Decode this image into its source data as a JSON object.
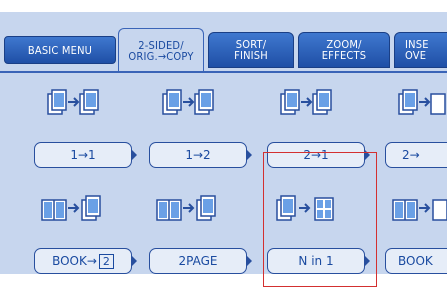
{
  "tabs": [
    {
      "id": "basic",
      "line1": "BASIC MENU",
      "line2": ""
    },
    {
      "id": "2sided",
      "line1": "2-SIDED/",
      "line2": "ORIG.→COPY"
    },
    {
      "id": "sort",
      "line1": "SORT/",
      "line2": "FINISH"
    },
    {
      "id": "zoom",
      "line1": "ZOOM/",
      "line2": "EFFECTS"
    },
    {
      "id": "inse",
      "line1": "INSE",
      "line2": "OVE"
    }
  ],
  "options": {
    "row1": [
      "1→1",
      "1→2",
      "2→1",
      "2→"
    ],
    "row2": [
      "BOOK→",
      "2PAGE",
      "N in 1",
      "BOOK"
    ]
  },
  "badges": {
    "row1": [
      "1",
      "1",
      "1",
      "2",
      "2",
      "1",
      "2"
    ],
    "book_badge": "2"
  }
}
